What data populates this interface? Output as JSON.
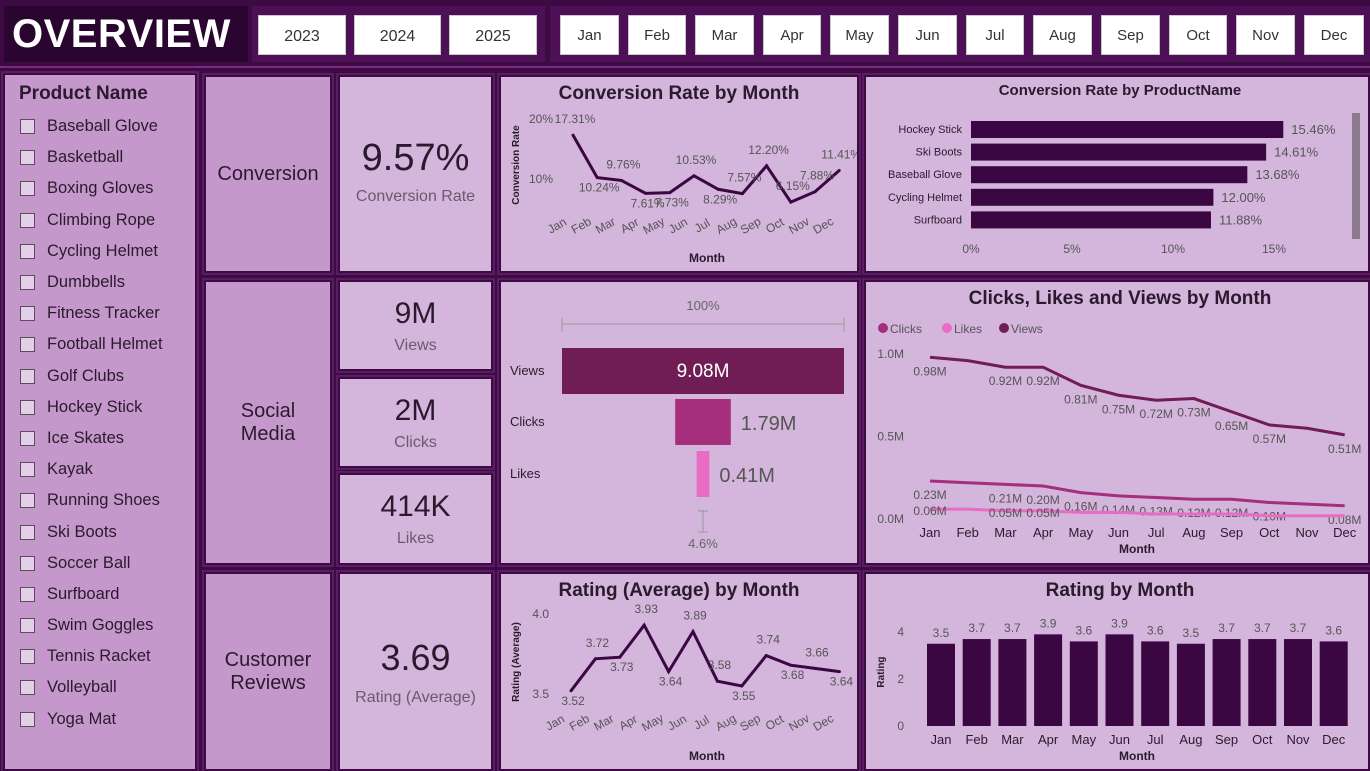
{
  "header": {
    "title": "OVERVIEW",
    "years": [
      "2023",
      "2024",
      "2025"
    ],
    "months": [
      "Jan",
      "Feb",
      "Mar",
      "Apr",
      "May",
      "Jun",
      "Jul",
      "Aug",
      "Sep",
      "Oct",
      "Nov",
      "Dec"
    ]
  },
  "sidebar": {
    "title": "Product Name",
    "items": [
      "Baseball Glove",
      "Basketball",
      "Boxing Gloves",
      "Climbing Rope",
      "Cycling Helmet",
      "Dumbbells",
      "Fitness Tracker",
      "Football Helmet",
      "Golf Clubs",
      "Hockey Stick",
      "Ice Skates",
      "Kayak",
      "Running Shoes",
      "Ski Boots",
      "Soccer Ball",
      "Surfboard",
      "Swim Goggles",
      "Tennis Racket",
      "Volleyball",
      "Yoga Mat"
    ]
  },
  "sections": {
    "conversion": "Conversion",
    "social": "Social Media",
    "reviews": "Customer Reviews"
  },
  "kpis": {
    "conversion_value": "9.57%",
    "conversion_label": "Conversion Rate",
    "views_value": "9M",
    "views_label": "Views",
    "clicks_value": "2M",
    "clicks_label": "Clicks",
    "likes_value": "414K",
    "likes_label": "Likes",
    "rating_value": "3.69",
    "rating_label": "Rating (Average)"
  },
  "colors": {
    "dark": "#3b0742",
    "views": "#6f1d54",
    "clicks": "#a52f7c",
    "likes": "#e86cc3"
  },
  "chart_data": [
    {
      "id": "conv_month",
      "type": "line",
      "title": "Conversion Rate by Month",
      "xlabel": "Month",
      "ylabel": "Conversion Rate",
      "yticks": [
        "20%",
        "10%"
      ],
      "categories": [
        "Jan",
        "Feb",
        "Mar",
        "Apr",
        "May",
        "Jun",
        "Jul",
        "Aug",
        "Sep",
        "Oct",
        "Nov",
        "Dec"
      ],
      "values": [
        17.31,
        10.24,
        9.76,
        7.61,
        7.73,
        10.53,
        8.29,
        7.57,
        12.2,
        6.15,
        7.88,
        11.41
      ],
      "labels": [
        "17.31%",
        "10.24%",
        "9.76%",
        "7.61%",
        "7.73%",
        "10.53%",
        "8.29%",
        "7.57%",
        "12.20%",
        "6.15%",
        "7.88%",
        "11.41%"
      ],
      "ylim": [
        5,
        20
      ]
    },
    {
      "id": "conv_product",
      "type": "bar",
      "orientation": "horizontal",
      "title": "Conversion Rate by ProductName",
      "categories": [
        "Hockey Stick",
        "Ski Boots",
        "Baseball Glove",
        "Cycling Helmet",
        "Surfboard"
      ],
      "values": [
        15.46,
        14.61,
        13.68,
        12.0,
        11.88
      ],
      "labels": [
        "15.46%",
        "14.61%",
        "13.68%",
        "12.00%",
        "11.88%"
      ],
      "xticks": [
        "0%",
        "5%",
        "10%",
        "15%"
      ],
      "xlim": [
        0,
        15
      ]
    },
    {
      "id": "funnel",
      "type": "bar",
      "subtype": "funnel",
      "categories": [
        "Views",
        "Clicks",
        "Likes"
      ],
      "values": [
        9.08,
        1.79,
        0.41
      ],
      "labels": [
        "9.08M",
        "1.79M",
        "0.41M"
      ],
      "top_label": "100%",
      "bottom_label": "4.6%"
    },
    {
      "id": "clv_month",
      "type": "line",
      "title": "Clicks, Likes and Views by Month",
      "xlabel": "Month",
      "yticks": [
        "1.0M",
        "0.5M",
        "0.0M"
      ],
      "categories": [
        "Jan",
        "Feb",
        "Mar",
        "Apr",
        "May",
        "Jun",
        "Jul",
        "Aug",
        "Sep",
        "Oct",
        "Nov",
        "Dec"
      ],
      "legend": [
        "Clicks",
        "Likes",
        "Views"
      ],
      "series": [
        {
          "name": "Views",
          "values": [
            0.98,
            0.96,
            0.92,
            0.92,
            0.81,
            0.75,
            0.72,
            0.73,
            0.65,
            0.57,
            0.55,
            0.51
          ],
          "labels": [
            "0.98M",
            "",
            "0.92M",
            "0.92M",
            "0.81M",
            "0.75M",
            "0.72M",
            "0.73M",
            "0.65M",
            "0.57M",
            "",
            "0.51M"
          ]
        },
        {
          "name": "Clicks",
          "values": [
            0.23,
            0.22,
            0.21,
            0.2,
            0.16,
            0.14,
            0.13,
            0.12,
            0.12,
            0.1,
            0.09,
            0.08
          ],
          "labels": [
            "0.23M",
            "",
            "0.21M",
            "0.20M",
            "0.16M",
            "0.14M",
            "0.13M",
            "0.12M",
            "0.12M",
            "0.10M",
            "",
            "0.08M"
          ]
        },
        {
          "name": "Likes",
          "values": [
            0.06,
            0.06,
            0.05,
            0.05,
            0.04,
            0.04,
            0.03,
            0.03,
            0.03,
            0.02,
            0.02,
            0.02
          ],
          "labels": [
            "0.06M",
            "",
            "0.05M",
            "0.05M",
            "",
            "",
            "",
            "",
            "",
            "",
            "",
            ""
          ]
        }
      ],
      "ylim": [
        0,
        1.0
      ]
    },
    {
      "id": "rating_line",
      "type": "line",
      "title": "Rating (Average) by Month",
      "xlabel": "Month",
      "ylabel": "Rating (Average)",
      "yticks": [
        "4.0",
        "3.5"
      ],
      "categories": [
        "Jan",
        "Feb",
        "Mar",
        "Apr",
        "May",
        "Jun",
        "Jul",
        "Aug",
        "Sep",
        "Oct",
        "Nov",
        "Dec"
      ],
      "values": [
        3.52,
        3.72,
        3.73,
        3.93,
        3.64,
        3.89,
        3.58,
        3.55,
        3.74,
        3.68,
        3.66,
        3.64
      ],
      "labels": [
        "3.52",
        "3.72",
        "3.73",
        "3.93",
        "3.64",
        "3.89",
        "3.58",
        "3.55",
        "3.74",
        "3.68",
        "3.66",
        "3.64"
      ],
      "ylim": [
        3.5,
        4.0
      ]
    },
    {
      "id": "rating_bar",
      "type": "bar",
      "title": "Rating by Month",
      "xlabel": "Month",
      "ylabel": "Rating",
      "yticks": [
        "4",
        "2",
        "0"
      ],
      "categories": [
        "Jan",
        "Feb",
        "Mar",
        "Apr",
        "May",
        "Jun",
        "Jul",
        "Aug",
        "Sep",
        "Oct",
        "Nov",
        "Dec"
      ],
      "values": [
        3.5,
        3.7,
        3.7,
        3.9,
        3.6,
        3.9,
        3.6,
        3.5,
        3.7,
        3.7,
        3.7,
        3.6
      ],
      "labels": [
        "3.5",
        "3.7",
        "3.7",
        "3.9",
        "3.6",
        "3.9",
        "3.6",
        "3.5",
        "3.7",
        "3.7",
        "3.7",
        "3.6"
      ],
      "ylim": [
        0,
        4.5
      ]
    }
  ]
}
